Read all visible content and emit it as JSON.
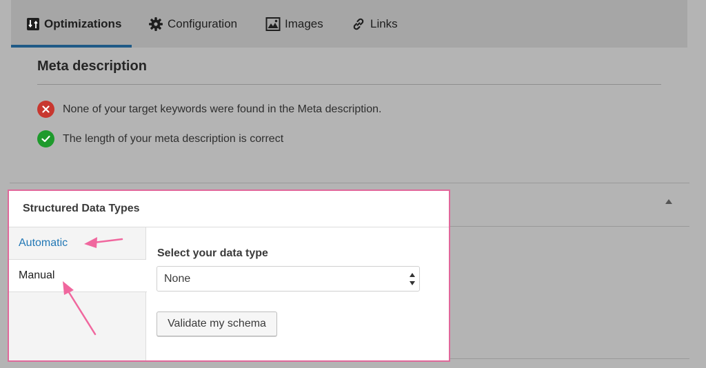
{
  "tabs": [
    {
      "label": "Optimizations",
      "icon": "optimizations-icon",
      "active": true
    },
    {
      "label": "Configuration",
      "icon": "gear-icon",
      "active": false
    },
    {
      "label": "Images",
      "icon": "image-icon",
      "active": false
    },
    {
      "label": "Links",
      "icon": "link-icon",
      "active": false
    }
  ],
  "meta_section": {
    "title": "Meta description",
    "checks": [
      {
        "status": "error",
        "text": "None of your target keywords were found in the Meta description."
      },
      {
        "status": "ok",
        "text": "The length of your meta description is correct"
      }
    ]
  },
  "structured_data": {
    "title": "Structured Data Types",
    "modes": [
      "Automatic",
      "Manual"
    ],
    "field_label": "Select your data type",
    "select_value": "None",
    "validate_label": "Validate my schema"
  },
  "colors": {
    "accent": "#1f5a86",
    "link": "#2177b5",
    "error": "#c8372f",
    "success": "#1e9a2c",
    "highlight": "#e0679a"
  }
}
